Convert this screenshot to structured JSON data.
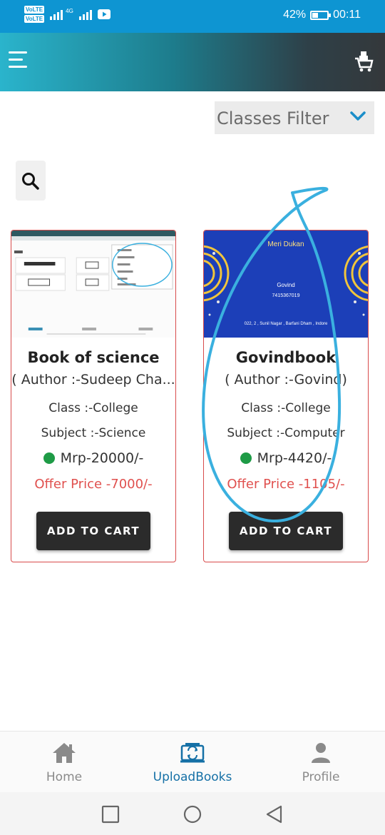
{
  "status_bar": {
    "volte_1": "VoLTE",
    "volte_2": "VoLTE",
    "network": "4G",
    "battery_text": "42%",
    "battery_level": 0.42,
    "time": "00:11"
  },
  "app_bar": {
    "menu_icon": "hamburger-menu-icon",
    "cart_icon": "shopping-cart-icon"
  },
  "filter": {
    "label": "Classes Filter",
    "icon": "chevron-down-icon"
  },
  "search": {
    "icon": "search-icon"
  },
  "books": [
    {
      "title": "Book of science",
      "author": "( Author :-Sudeep Cha...",
      "class": "Class :-College",
      "subject": "Subject :-Science",
      "mrp": "Mrp-20000/-",
      "offer": "Offer Price -7000/-",
      "button": "ADD TO CART"
    },
    {
      "title": "Govindbook",
      "author": "( Author :-Govind)",
      "class": "Class :-College",
      "subject": "Subject :-Computer",
      "mrp": "Mrp-4420/-",
      "offer": "Offer Price -1105/-",
      "button": "ADD TO CART",
      "cover": {
        "heading": "Meri Dukan",
        "name": "Govind",
        "phone": "7415367019",
        "address": "022, 2 , Sunil Nagar , Barfani Dham , Indore"
      }
    }
  ],
  "bottom_nav": [
    {
      "label": "Home",
      "icon": "home-icon",
      "active": false
    },
    {
      "label": "UploadBooks",
      "icon": "upload-books-icon",
      "active": true
    },
    {
      "label": "Profile",
      "icon": "person-icon",
      "active": false
    }
  ],
  "colors": {
    "status_bar": "#0e95d2",
    "card_border": "#d84b4b",
    "offer": "#e0504e",
    "active_nav": "#1570a6",
    "annotation": "#3ab0df",
    "cover_bg": "#1c3fb8"
  }
}
